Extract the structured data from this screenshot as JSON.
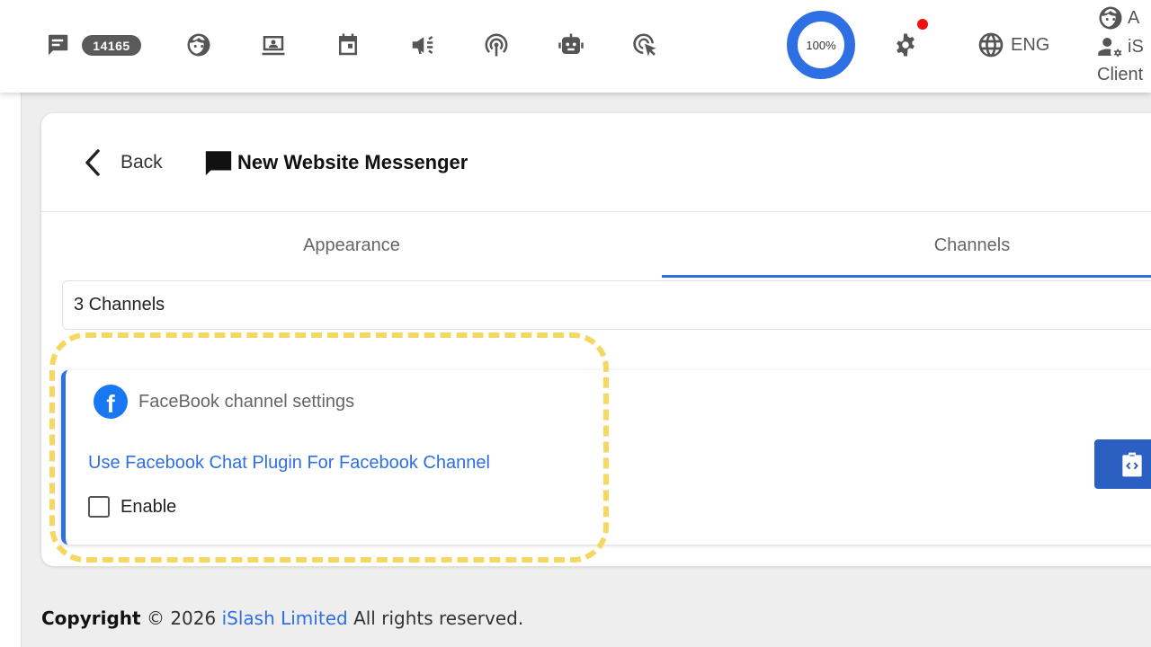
{
  "topbar": {
    "message_count": "14165",
    "progress_label": "100%",
    "progress_value": 1.0,
    "language": "ENG",
    "user_name_partial": "A",
    "org_partial": "iS",
    "user_role": "Client"
  },
  "page": {
    "back_label": "Back",
    "title": "New Website Messenger",
    "tabs": [
      {
        "label": "Appearance",
        "active": false
      },
      {
        "label": "Channels",
        "active": true
      }
    ],
    "channels_count": "3 Channels"
  },
  "facebook": {
    "heading": "FaceBook channel settings",
    "logo_letter": "f",
    "plugin_link": "Use Facebook Chat Plugin For Facebook Channel",
    "enable_label": "Enable",
    "enabled": false
  },
  "footer": {
    "copyright": "Copyright",
    "symbol_year": "© 2026",
    "company": "iSlash Limited",
    "rights": "All rights reserved."
  },
  "colors": {
    "accent": "#2f6fe4",
    "facebook": "#1877f2",
    "highlight": "#f5d863",
    "notification": "#e11111"
  }
}
